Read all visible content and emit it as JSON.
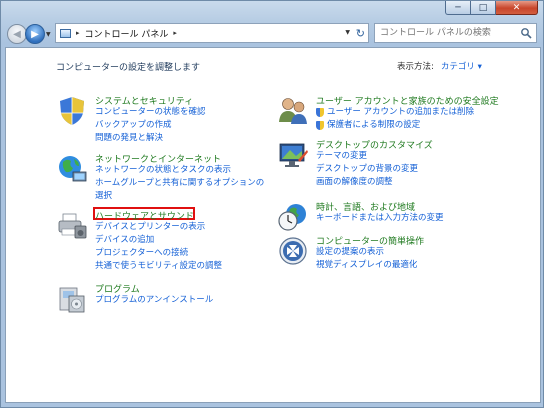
{
  "window": {
    "controls": {
      "minimize": "─",
      "maximize": "□",
      "close": "✕"
    }
  },
  "nav": {
    "back": "◀",
    "forward": "▶",
    "breadcrumb": "コントロール パネル",
    "search_placeholder": "コントロール パネルの検索"
  },
  "main": {
    "title": "コンピューターの設定を調整します",
    "view_by_label": "表示方法:",
    "view_by_value": "カテゴリ ▾"
  },
  "categories": {
    "system": {
      "title": "システムとセキュリティ",
      "links": [
        "コンピューターの状態を確認",
        "バックアップの作成",
        "問題の発見と解決"
      ]
    },
    "network": {
      "title": "ネットワークとインターネット",
      "links": [
        "ネットワークの状態とタスクの表示",
        "ホームグループと共有に関するオプションの",
        "選択"
      ]
    },
    "hardware": {
      "title": "ハードウェアとサウンド",
      "links": [
        "デバイスとプリンターの表示",
        "デバイスの追加",
        "プロジェクターへの接続",
        "共通で使うモビリティ設定の調整"
      ]
    },
    "programs": {
      "title": "プログラム",
      "links": [
        "プログラムのアンインストール"
      ]
    },
    "users": {
      "title": "ユーザー アカウントと家族のための安全設定",
      "links": [
        "ユーザー アカウントの追加または削除",
        "保護者による制限の設定"
      ]
    },
    "appearance": {
      "title": "デスクトップのカスタマイズ",
      "links": [
        "テーマの変更",
        "デスクトップの背景の変更",
        "画面の解像度の調整"
      ]
    },
    "clock": {
      "title": "時計、言語、および地域",
      "links": [
        "キーボードまたは入力方法の変更"
      ]
    },
    "access": {
      "title": "コンピューターの簡単操作",
      "links": [
        "設定の提案の表示",
        "視覚ディスプレイの最適化"
      ]
    }
  },
  "colors": {
    "link": "#1460d6",
    "category": "#1f7a1f",
    "highlight": "#e01010"
  }
}
